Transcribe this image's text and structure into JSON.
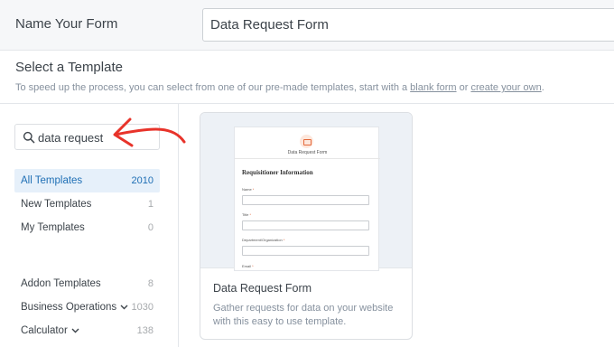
{
  "header": {
    "form_name_label": "Name Your Form",
    "form_name_value": "Data Request Form"
  },
  "template_section": {
    "heading": "Select a Template",
    "description_prefix": "To speed up the process, you can select from one of our pre-made templates, start with a ",
    "blank_form_link": "blank form",
    "description_middle": " or ",
    "create_own_link": "create your own",
    "description_suffix": "."
  },
  "search": {
    "value": "data request",
    "icon": "search-icon"
  },
  "annotation": {
    "arrow_color": "#e8332a"
  },
  "categories": [
    {
      "label": "All Templates",
      "count": "2010",
      "active": true
    },
    {
      "label": "New Templates",
      "count": "1",
      "active": false
    },
    {
      "label": "My Templates",
      "count": "0",
      "active": false
    }
  ],
  "categories_2": [
    {
      "label": "Addon Templates",
      "count": "8",
      "has_chevron": false
    },
    {
      "label": "Business Operations",
      "count": "1030",
      "has_chevron": true
    },
    {
      "label": "Calculator",
      "count": "138",
      "has_chevron": true
    }
  ],
  "template_card": {
    "title": "Data Request Form",
    "description": "Gather requests for data on your website with this easy to use template.",
    "preview": {
      "form_title": "Data Request Form",
      "section_title": "Requisitioner Information",
      "fields": [
        "Name",
        "Title",
        "Department/Organization",
        "Email"
      ],
      "required_marker": "*"
    }
  },
  "colors": {
    "accent_blue": "#1f6fb5",
    "active_bg": "#e6f0fa",
    "brand_orange": "#e4683a"
  }
}
